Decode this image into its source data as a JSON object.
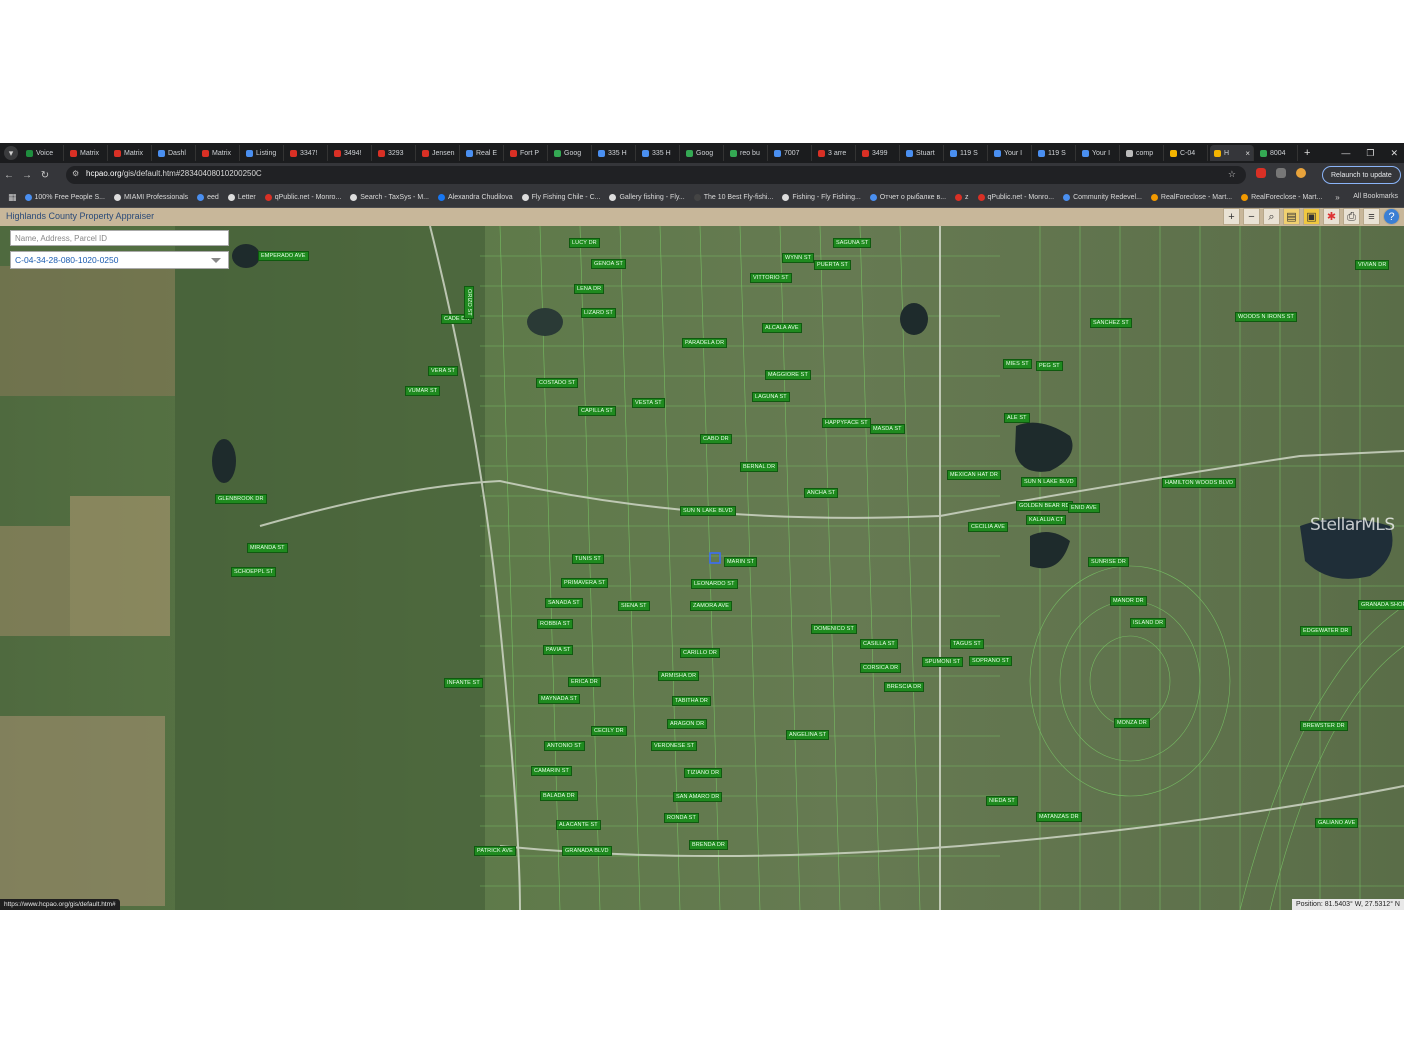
{
  "browser": {
    "tabs": [
      {
        "label": "Voice",
        "color": "#1e8e3e"
      },
      {
        "label": "Matrix",
        "color": "#d93025"
      },
      {
        "label": "Matrix",
        "color": "#d93025"
      },
      {
        "label": "Dashl",
        "color": "#4a8ff0"
      },
      {
        "label": "Matrix",
        "color": "#d93025"
      },
      {
        "label": "Listing",
        "color": "#4a8ff0"
      },
      {
        "label": "3347!",
        "color": "#d93025"
      },
      {
        "label": "3494!",
        "color": "#d93025"
      },
      {
        "label": "3293",
        "color": "#d93025"
      },
      {
        "label": "Jensen",
        "color": "#d93025"
      },
      {
        "label": "Real E",
        "color": "#4a8ff0"
      },
      {
        "label": "Fort P",
        "color": "#d93025"
      },
      {
        "label": "Goog",
        "color": "#34a853"
      },
      {
        "label": "335 H",
        "color": "#4a8ff0"
      },
      {
        "label": "335 H",
        "color": "#4a8ff0"
      },
      {
        "label": "Goog",
        "color": "#34a853"
      },
      {
        "label": "reo bu",
        "color": "#34a853"
      },
      {
        "label": "7007",
        "color": "#4a8ff0"
      },
      {
        "label": "3 arre",
        "color": "#d93025"
      },
      {
        "label": "3499",
        "color": "#d93025"
      },
      {
        "label": "Stuart",
        "color": "#4a8ff0"
      },
      {
        "label": "119 S",
        "color": "#4a8ff0"
      },
      {
        "label": "Your I",
        "color": "#4a8ff0"
      },
      {
        "label": "119 S",
        "color": "#4a8ff0"
      },
      {
        "label": "Your I",
        "color": "#4a8ff0"
      },
      {
        "label": "comp",
        "color": "#bbbbbb"
      },
      {
        "label": "C-04",
        "color": "#f4b400"
      },
      {
        "label": "H",
        "color": "#f4b400",
        "active": true
      },
      {
        "label": "8004",
        "color": "#34a853"
      }
    ],
    "url_host": "hcpao.org",
    "url_path": "/gis/default.htm#28340408010200250C",
    "relaunch_label": "Relaunch to update",
    "bookmarks": [
      {
        "label": "100% Free People S...",
        "color": "#4a8ff0"
      },
      {
        "label": "MIAMI Professionals",
        "color": "#dddddd"
      },
      {
        "label": "eed",
        "color": "#4a8ff0"
      },
      {
        "label": "Letter",
        "color": "#dddddd"
      },
      {
        "label": "qPublic.net - Monro...",
        "color": "#d93025"
      },
      {
        "label": "Search - TaxSys - M...",
        "color": "#dddddd"
      },
      {
        "label": "Alexandra Chudilova",
        "color": "#1877f2"
      },
      {
        "label": "Fly Fishing Chile - C...",
        "color": "#dddddd"
      },
      {
        "label": "Gallery fishing - Fly...",
        "color": "#dddddd"
      },
      {
        "label": "The 10 Best Fly-fishi...",
        "color": "#444444"
      },
      {
        "label": "Fishing - Fly Fishing...",
        "color": "#dddddd"
      },
      {
        "label": "Отчет о рыбалке в...",
        "color": "#4a8ff0"
      },
      {
        "label": "z",
        "color": "#d93025"
      },
      {
        "label": "qPublic.net - Monro...",
        "color": "#d93025"
      },
      {
        "label": "Community Redevel...",
        "color": "#4a8ff0"
      },
      {
        "label": "RealForeclose - Mart...",
        "color": "#f29900"
      },
      {
        "label": "RealForeclose - Mart...",
        "color": "#f29900"
      }
    ],
    "all_bookmarks": "All Bookmarks",
    "status_url": "https://www.hcpao.org/gis/default.htm#"
  },
  "app": {
    "title": "Highlands County Property Appraiser",
    "search_placeholder": "Name, Address, Parcel ID",
    "parcel_selected": "C-04-34-28-080-1020-0250",
    "tools": [
      "zoom-in",
      "zoom-out",
      "zoom-box",
      "layers",
      "select",
      "identify",
      "print",
      "menu",
      "help"
    ],
    "position": "Position: 81.5403° W, 27.5312° N",
    "watermark": "StellarMLS"
  },
  "streets": [
    {
      "t": "EMPERADO AVE"
    },
    {
      "t": "LUCY DR"
    },
    {
      "t": "GENOA ST"
    },
    {
      "t": "LENA DR"
    },
    {
      "t": "LIZARD ST"
    },
    {
      "t": "CADE DR"
    },
    {
      "t": "ORIZO ST"
    },
    {
      "t": "VERA ST"
    },
    {
      "t": "VUMAR ST"
    },
    {
      "t": "COSTADO ST"
    },
    {
      "t": "CAPILLA ST"
    },
    {
      "t": "VESTA ST"
    },
    {
      "t": "PARADELA DR"
    },
    {
      "t": "ALCALA AVE"
    },
    {
      "t": "VITTORIO ST"
    },
    {
      "t": "WYNN ST"
    },
    {
      "t": "SAGUNA ST"
    },
    {
      "t": "PUERTA ST"
    },
    {
      "t": "MAGGIORE ST"
    },
    {
      "t": "LAGUNA ST"
    },
    {
      "t": "HAPPYFACE ST"
    },
    {
      "t": "MASDA ST"
    },
    {
      "t": "CABO DR"
    },
    {
      "t": "BERNAL DR"
    },
    {
      "t": "ANCHA ST"
    },
    {
      "t": "SUN N LAKE BLVD"
    },
    {
      "t": "GLENBROOK DR"
    },
    {
      "t": "MIRANDA ST"
    },
    {
      "t": "SCHOEPPL ST"
    },
    {
      "t": "TUNIS ST"
    },
    {
      "t": "PRIMAVERA ST"
    },
    {
      "t": "SANADA ST"
    },
    {
      "t": "SIENA ST"
    },
    {
      "t": "ROBBIA ST"
    },
    {
      "t": "PAVIA ST"
    },
    {
      "t": "ERICA DR"
    },
    {
      "t": "MARIN ST"
    },
    {
      "t": "LEONARDO ST"
    },
    {
      "t": "ZAMORA AVE"
    },
    {
      "t": "CARILLO DR"
    },
    {
      "t": "ARMISHA DR"
    },
    {
      "t": "TABITHA DR"
    },
    {
      "t": "ARAGON DR"
    },
    {
      "t": "VERONESE ST"
    },
    {
      "t": "INFANTE ST"
    },
    {
      "t": "MAYNADA ST"
    },
    {
      "t": "CECILY DR"
    },
    {
      "t": "ANTONIO ST"
    },
    {
      "t": "CAMARIN ST"
    },
    {
      "t": "BALADA DR"
    },
    {
      "t": "ALACANTE ST"
    },
    {
      "t": "GRANADA BLVD"
    },
    {
      "t": "PATRICK AVE"
    },
    {
      "t": "TIZIANO DR"
    },
    {
      "t": "SAN AMARO DR"
    },
    {
      "t": "RONDA ST"
    },
    {
      "t": "BRENDA DR"
    },
    {
      "t": "DOMENICO ST"
    },
    {
      "t": "CASILLA ST"
    },
    {
      "t": "CORSICA DR"
    },
    {
      "t": "BRESCIA DR"
    },
    {
      "t": "ANGELINA ST"
    },
    {
      "t": "SPUMONI ST"
    },
    {
      "t": "TAGUS ST"
    },
    {
      "t": "SOPRANO ST"
    },
    {
      "t": "NIEDA ST"
    },
    {
      "t": "MATANZAS DR"
    },
    {
      "t": "MONZA DR"
    },
    {
      "t": "ISLAND DR"
    },
    {
      "t": "MANOR DR"
    },
    {
      "t": "SUNRISE DR"
    },
    {
      "t": "CECILIA AVE"
    },
    {
      "t": "KALALUA CT"
    },
    {
      "t": "GOLDEN BEAR RD"
    },
    {
      "t": "SUN N LAKE BLVD"
    },
    {
      "t": "ENID AVE"
    },
    {
      "t": "HAMILTON WOODS BLVD"
    },
    {
      "t": "MEXICAN HAT DR"
    },
    {
      "t": "WOODS N IRONS ST"
    },
    {
      "t": "VIVIAN DR"
    },
    {
      "t": "SANCHEZ ST"
    },
    {
      "t": "MIES ST"
    },
    {
      "t": "PEG ST"
    },
    {
      "t": "ALE ST"
    },
    {
      "t": "GRANADA SHORES DR"
    },
    {
      "t": "EDGEWATER DR"
    },
    {
      "t": "GALIANO AVE"
    },
    {
      "t": "BREWSTER DR"
    }
  ]
}
